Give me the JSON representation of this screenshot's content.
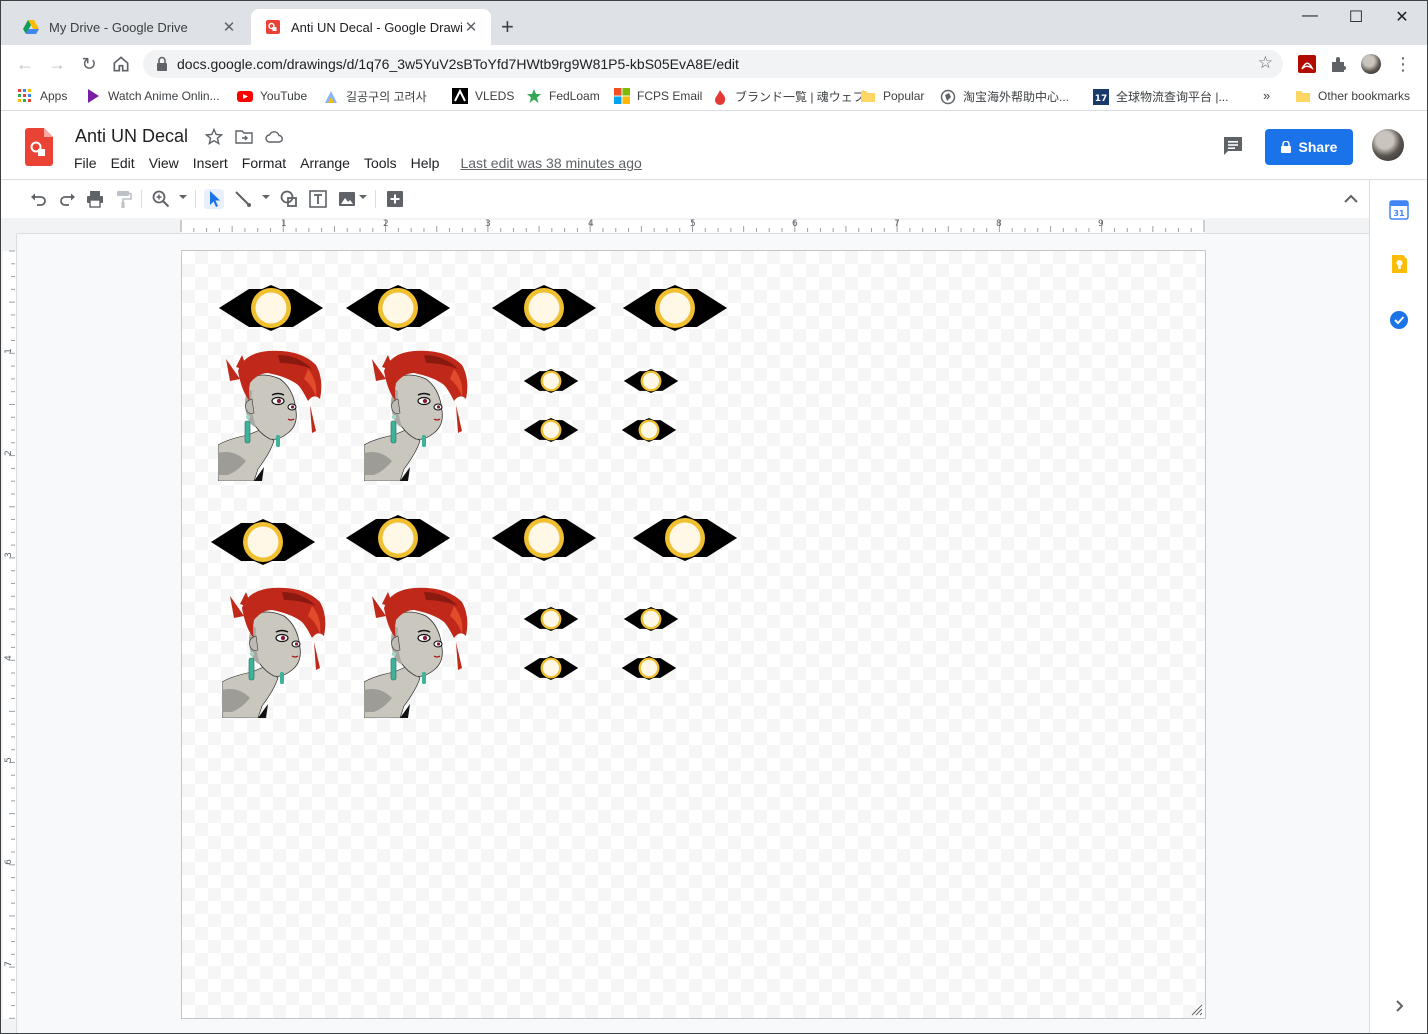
{
  "browser": {
    "tabs": [
      {
        "title": "My Drive - Google Drive"
      },
      {
        "title": "Anti UN Decal - Google Drawings"
      }
    ],
    "url": "docs.google.com/drawings/d/1q76_3w5YuV2sBToYfd7HWtb9rg9W81P5-kbS05EvA8E/edit",
    "bookmarks": [
      "Apps",
      "Watch Anime Onlin...",
      "YouTube",
      "길공구의 고려사",
      "VLEDS",
      "FedLoam",
      "FCPS Email",
      "ブランド一覧 | 魂ウェブ",
      "Popular",
      "淘宝海外帮助中心...",
      "全球物流查询平台 |...",
      "Other bookmarks"
    ],
    "bookmarks_overflow": "»"
  },
  "doc": {
    "title": "Anti UN Decal",
    "menus": [
      "File",
      "Edit",
      "View",
      "Insert",
      "Format",
      "Arrange",
      "Tools",
      "Help"
    ],
    "last_edit": "Last edit was 38 minutes ago",
    "share_label": "Share"
  },
  "ruler": {
    "h_numbers": [
      "1",
      "2",
      "3",
      "4",
      "5",
      "6",
      "7",
      "8",
      "9"
    ],
    "v_numbers": [
      "1",
      "2",
      "3",
      "4",
      "5",
      "6",
      "7"
    ]
  },
  "side_panel": {
    "calendar_day": "31"
  },
  "colors": {
    "share_blue": "#1a73e8",
    "eye_ring": "#f0c030",
    "hair_red": "#c0281a",
    "docs_red": "#ea4335"
  },
  "canvas_objects": {
    "large_eye_count": 8,
    "small_eye_count": 8,
    "character_count": 4
  }
}
